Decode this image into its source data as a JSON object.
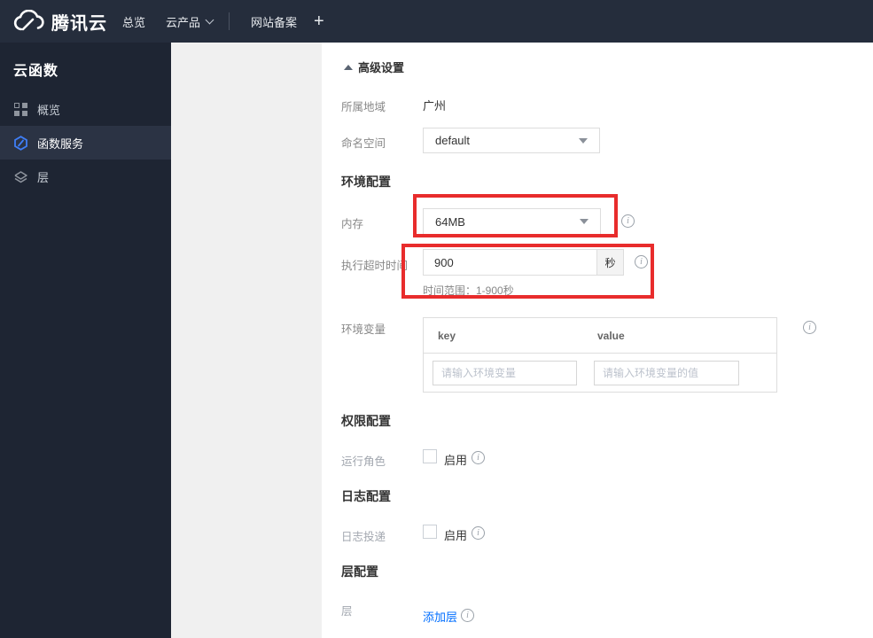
{
  "navbar": {
    "brand": "腾讯云",
    "overview": "总览",
    "products": "云产品",
    "icp": "网站备案",
    "plus": "+"
  },
  "sidebar": {
    "title": "云函数",
    "items": [
      {
        "label": "概览",
        "icon": "grid-icon",
        "selected": false
      },
      {
        "label": "函数服务",
        "icon": "function-hexagon-icon",
        "selected": true
      },
      {
        "label": "层",
        "icon": "layers-icon",
        "selected": false
      }
    ]
  },
  "content": {
    "advanced_settings": "高级设置",
    "region": {
      "label": "所属地域",
      "value": "广州"
    },
    "namespace": {
      "label": "命名空间",
      "value": "default"
    },
    "env_section": "环境配置",
    "memory": {
      "label": "内存",
      "value": "64MB"
    },
    "timeout": {
      "label": "执行超时时间",
      "value": "900",
      "unit": "秒",
      "hint": "时间范围：1-900秒"
    },
    "env_vars": {
      "label": "环境变量",
      "key_header": "key",
      "value_header": "value",
      "key_placeholder": "请输入环境变量",
      "value_placeholder": "请输入环境变量的值"
    },
    "perm_section": "权限配置",
    "role": {
      "label": "运行角色",
      "enable": "启用"
    },
    "log_section": "日志配置",
    "log": {
      "label": "日志投递",
      "enable": "启用"
    },
    "layer_section": "层配置",
    "layer": {
      "label": "层",
      "link": "添加层"
    }
  },
  "colors": {
    "navbar_bg": "#252d3c",
    "sidebar_bg": "#1e2533",
    "sidebar_selected_bg": "#2b3344",
    "annotation_red": "#e82c2c",
    "link_blue": "#006eff",
    "function_icon_blue": "#3f7ef7",
    "panel_gray": "#f0f0f0"
  }
}
